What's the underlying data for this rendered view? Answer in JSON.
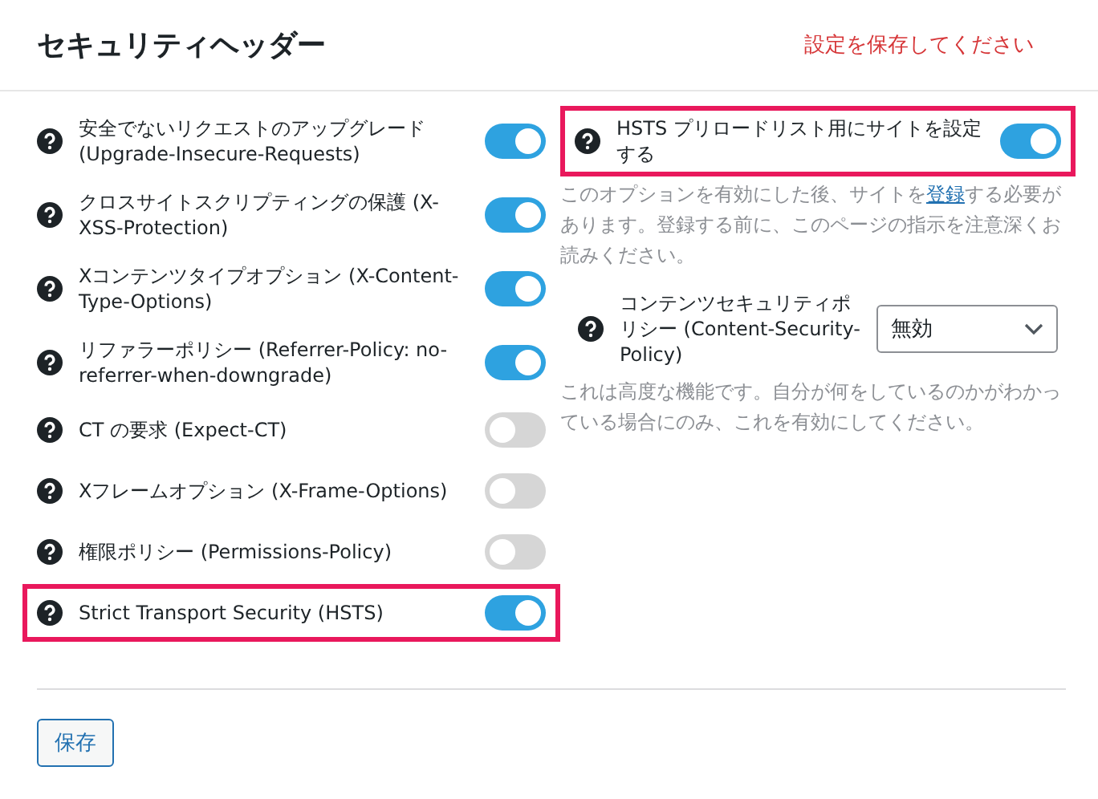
{
  "header": {
    "title": "セキュリティヘッダー",
    "notice": "設定を保存してください"
  },
  "left_options": [
    {
      "label": "安全でないリクエストのアップグレード (Upgrade-Insecure-Requests)",
      "on": true,
      "highlighted": false
    },
    {
      "label": "クロスサイトスクリプティングの保護 (X-XSS-Protection)",
      "on": true,
      "highlighted": false
    },
    {
      "label": "Xコンテンツタイプオプション (X-Content-Type-Options)",
      "on": true,
      "highlighted": false
    },
    {
      "label": "リファラーポリシー (Referrer-Policy: no-referrer-when-downgrade)",
      "on": true,
      "highlighted": false
    },
    {
      "label": "CT の要求 (Expect-CT)",
      "on": false,
      "highlighted": false
    },
    {
      "label": "Xフレームオプション (X-Frame-Options)",
      "on": false,
      "highlighted": false
    },
    {
      "label": "権限ポリシー (Permissions-Policy)",
      "on": false,
      "highlighted": false
    },
    {
      "label": "Strict Transport Security (HSTS)",
      "on": true,
      "highlighted": true
    }
  ],
  "preload": {
    "label": "HSTS プリロードリスト用にサイトを設定する",
    "on": true,
    "highlighted": true,
    "description": {
      "before": "このオプションを有効にした後、サイトを",
      "link": "登録",
      "after": "する必要があります。登録する前に、このページの指示を注意深くお読みください。"
    }
  },
  "csp": {
    "label": "コンテンツセキュリティポリシー (Content-Security-Policy)",
    "value": "無効",
    "description": "これは高度な機能です。自分が何をしているのかがわかっている場合にのみ、これを有効にしてください。"
  },
  "save_button": "保存"
}
